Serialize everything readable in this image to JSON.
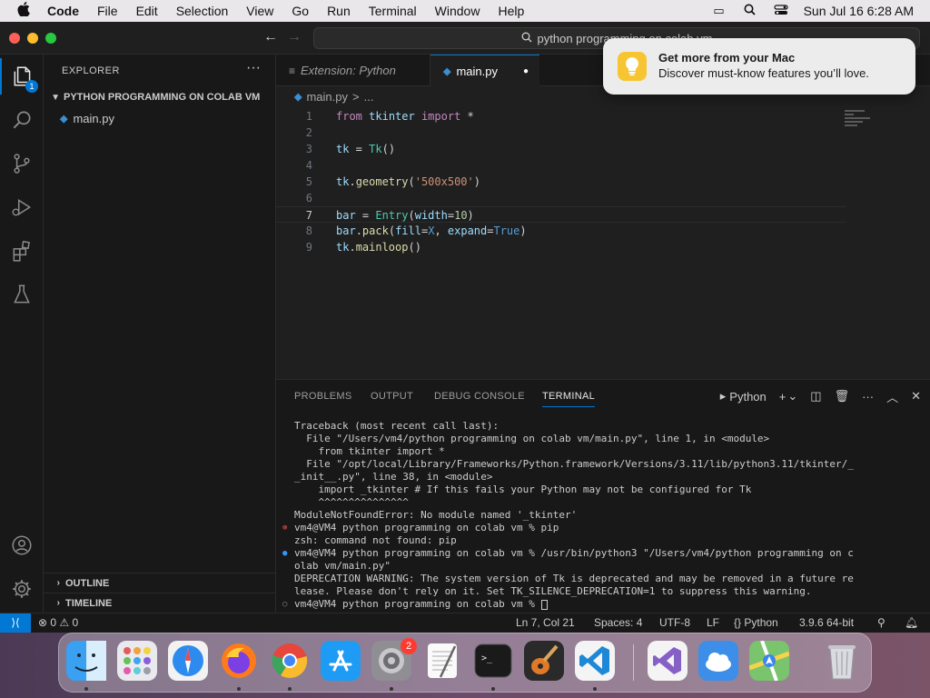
{
  "menubar": {
    "apple": "",
    "items": [
      "Code",
      "File",
      "Edit",
      "Selection",
      "View",
      "Go",
      "Run",
      "Terminal",
      "Window",
      "Help"
    ],
    "clock": "Sun Jul 16  6:28 AM"
  },
  "titlebar": {
    "search_text": "python programming on colab vm"
  },
  "activity": {
    "explorer_badge": "1"
  },
  "sidebar": {
    "title": "EXPLORER",
    "more": "···",
    "folder": "PYTHON PROGRAMMING ON COLAB VM",
    "files": [
      "main.py"
    ],
    "outline": "OUTLINE",
    "timeline": "TIMELINE"
  },
  "tabs": {
    "inactive": "Extension: Python",
    "active": "main.py"
  },
  "breadcrumb": {
    "file": "main.py",
    "sep": ">",
    "rest": "..."
  },
  "editor": {
    "current_line": 7,
    "lines": [
      "from tkinter import *",
      "",
      "tk = Tk()",
      "",
      "tk.geometry('500x500')",
      "",
      "bar = Entry(width=10)",
      "bar.pack(fill=X, expand=True)",
      "tk.mainloop()"
    ]
  },
  "panel": {
    "tabs": [
      "PROBLEMS",
      "OUTPUT",
      "DEBUG CONSOLE",
      "TERMINAL"
    ],
    "active_tab": "TERMINAL",
    "shell_label": "Python",
    "terminal_lines": [
      {
        "mark": "",
        "text": "Traceback (most recent call last):"
      },
      {
        "mark": "",
        "text": "  File \"/Users/vm4/python programming on colab vm/main.py\", line 1, in <module>"
      },
      {
        "mark": "",
        "text": "    from tkinter import *"
      },
      {
        "mark": "",
        "text": "  File \"/opt/local/Library/Frameworks/Python.framework/Versions/3.11/lib/python3.11/tkinter/_"
      },
      {
        "mark": "",
        "text": "_init__.py\", line 38, in <module>"
      },
      {
        "mark": "",
        "text": "    import _tkinter # If this fails your Python may not be configured for Tk"
      },
      {
        "mark": "",
        "text": "    ^^^^^^^^^^^^^^^"
      },
      {
        "mark": "",
        "text": "ModuleNotFoundError: No module named '_tkinter'"
      },
      {
        "mark": "err",
        "text": "vm4@VM4 python programming on colab vm % pip"
      },
      {
        "mark": "",
        "text": "zsh: command not found: pip"
      },
      {
        "mark": "ok",
        "text": "vm4@VM4 python programming on colab vm % /usr/bin/python3 \"/Users/vm4/python programming on c"
      },
      {
        "mark": "",
        "text": "olab vm/main.py\""
      },
      {
        "mark": "",
        "text": "DEPRECATION WARNING: The system version of Tk is deprecated and may be removed in a future re"
      },
      {
        "mark": "",
        "text": "lease. Please don't rely on it. Set TK_SILENCE_DEPRECATION=1 to suppress this warning."
      },
      {
        "mark": "idle",
        "text": "vm4@VM4 python programming on colab vm % "
      }
    ]
  },
  "statusbar": {
    "problems": "⊗ 0 ⚠ 0",
    "position": "Ln 7, Col 21",
    "spaces": "Spaces: 4",
    "encoding": "UTF-8",
    "eol": "LF",
    "language": "Python",
    "interpreter": "3.9.6 64-bit"
  },
  "notification": {
    "title": "Get more from your Mac",
    "body": "Discover must-know features you’ll love."
  },
  "dock": {
    "apps": [
      "finder",
      "launchpad",
      "safari",
      "firefox",
      "chrome",
      "app-store",
      "system-settings",
      "textedit",
      "terminal",
      "garageband",
      "vscode",
      "visual-studio",
      "icloud-weather",
      "maps",
      "trash"
    ],
    "settings_badge": "2"
  },
  "colors": {
    "accent": "#0078d4",
    "editor_bg": "#1f1f1f",
    "sidebar_bg": "#181818"
  }
}
